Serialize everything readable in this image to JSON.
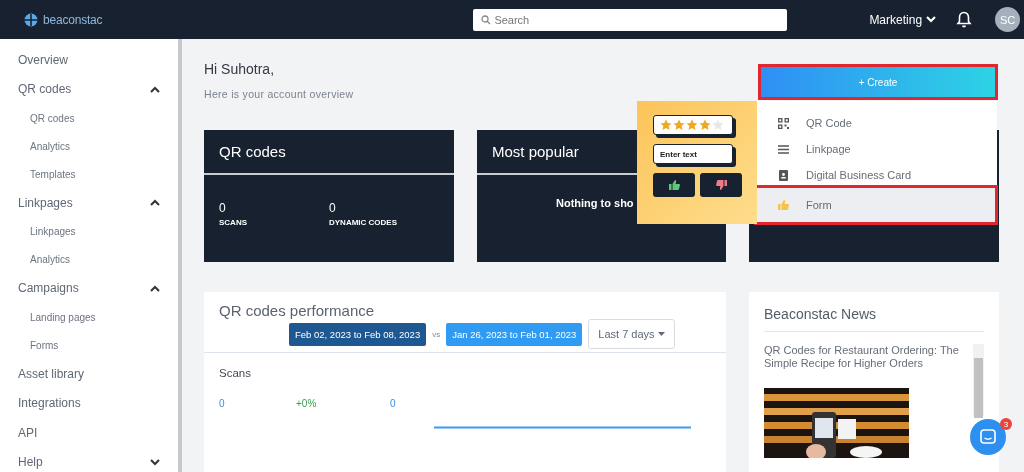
{
  "header": {
    "logo": "beaconstac",
    "search": {
      "placeholder": "Search"
    },
    "workspace": "Marketing",
    "avatar": "SC"
  },
  "sidebar": {
    "items": [
      {
        "label": "Overview"
      },
      {
        "label": "QR codes",
        "expanded": true,
        "children": [
          {
            "label": "QR codes"
          },
          {
            "label": "Analytics"
          },
          {
            "label": "Templates"
          }
        ]
      },
      {
        "label": "Linkpages",
        "expanded": true,
        "children": [
          {
            "label": "Linkpages"
          },
          {
            "label": "Analytics"
          }
        ]
      },
      {
        "label": "Campaigns",
        "expanded": true,
        "children": [
          {
            "label": "Landing pages"
          },
          {
            "label": "Forms"
          }
        ]
      },
      {
        "label": "Asset library"
      },
      {
        "label": "Integrations"
      },
      {
        "label": "API"
      },
      {
        "label": "Help",
        "expanded": false
      }
    ]
  },
  "greeting": {
    "title": "Hi Suhotra,",
    "subtitle": "Here is your account overview"
  },
  "qr_card": {
    "title": "QR codes",
    "stats": [
      {
        "value": "0",
        "label": "SCANS"
      },
      {
        "value": "0",
        "label": "DYNAMIC CODES"
      }
    ]
  },
  "popular_card": {
    "title": "Most popular",
    "empty_text": "Nothing to sho"
  },
  "create": {
    "label": "+ Create",
    "annotated": true,
    "menu": [
      {
        "label": "QR Code",
        "selected": false,
        "annotated": false
      },
      {
        "label": "Linkpage",
        "selected": false,
        "annotated": false
      },
      {
        "label": "Digital Business Card",
        "selected": false,
        "annotated": false
      },
      {
        "label": "Form",
        "selected": true,
        "annotated": true
      }
    ]
  },
  "form_preview": {
    "stars": 4,
    "text_field": "Enter text"
  },
  "performance": {
    "title": "QR codes performance",
    "range": "Feb 02, 2023 to Feb 08, 2023",
    "vs": "vs",
    "compare_range": "Jan 26, 2023 to Feb 01, 2023",
    "period": "Last 7 days",
    "metric": "Scans",
    "current": "0",
    "change": "+0%",
    "previous": "0"
  },
  "news": {
    "title": "Beaconstac News",
    "article": "QR Codes for Restaurant Ordering: The Simple Recipe for Higher Orders"
  },
  "chat": {
    "badge": "3"
  }
}
